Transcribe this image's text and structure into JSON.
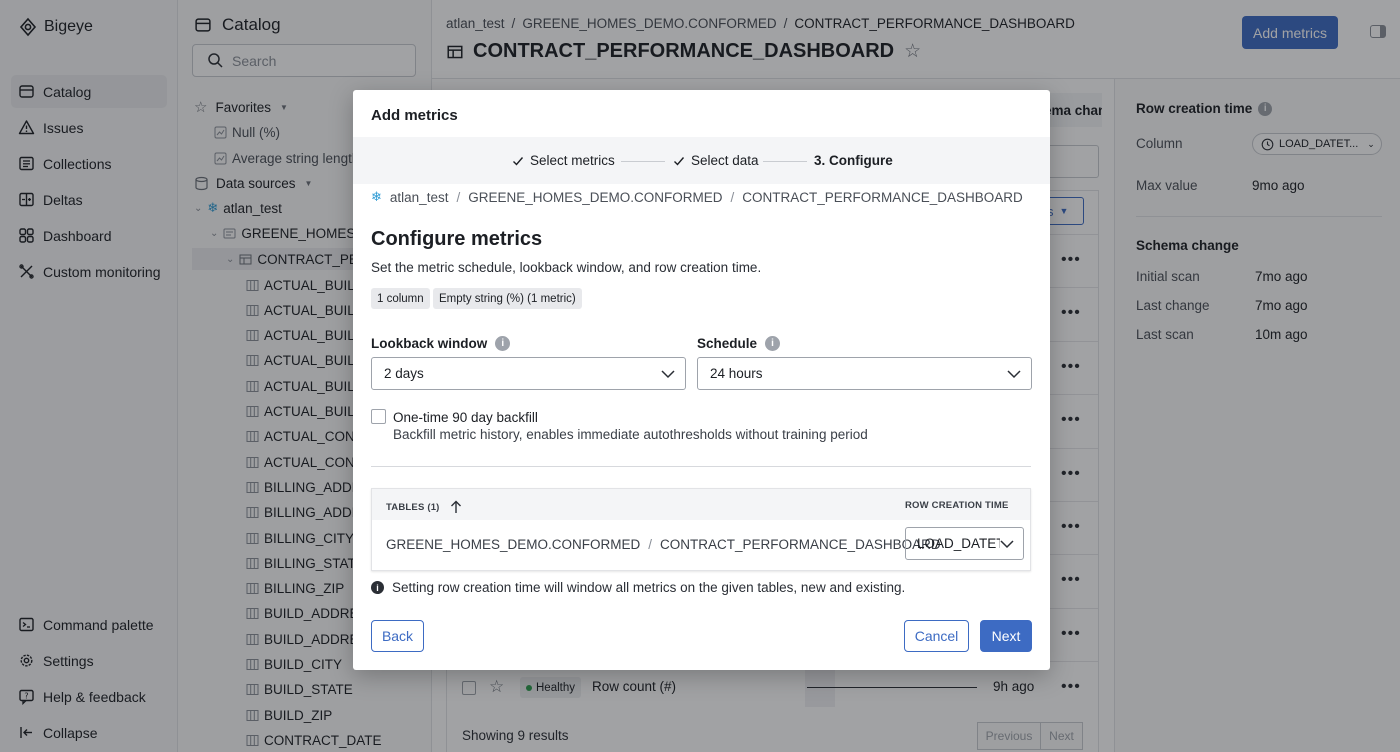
{
  "app": {
    "name": "Bigeye"
  },
  "nav": {
    "items": [
      {
        "label": "Catalog",
        "icon": "catalog-icon"
      },
      {
        "label": "Issues",
        "icon": "warning-icon"
      },
      {
        "label": "Collections",
        "icon": "collections-icon"
      },
      {
        "label": "Deltas",
        "icon": "deltas-icon"
      },
      {
        "label": "Dashboard",
        "icon": "dashboard-icon"
      },
      {
        "label": "Custom monitoring",
        "icon": "custom-monitoring-icon"
      }
    ],
    "bottom": [
      {
        "label": "Command palette",
        "icon": "command-icon"
      },
      {
        "label": "Settings",
        "icon": "gear-icon"
      },
      {
        "label": "Help & feedback",
        "icon": "help-icon"
      },
      {
        "label": "Collapse",
        "icon": "collapse-icon"
      }
    ]
  },
  "catalog": {
    "title": "Catalog",
    "search_placeholder": "Search",
    "favorites": "Favorites",
    "fav_items": [
      "Null (%)",
      "Average string length"
    ],
    "data_sources": "Data sources",
    "source": "atlan_test",
    "schema": "GREENE_HOMES_",
    "table": "CONTRACT_PE",
    "columns": [
      "ACTUAL_BUILD",
      "ACTUAL_BUILD",
      "ACTUAL_BUILD",
      "ACTUAL_BUILD",
      "ACTUAL_BUILD",
      "ACTUAL_BUILD",
      "ACTUAL_CONT",
      "ACTUAL_CONT",
      "BILLING_ADDR",
      "BILLING_ADDR",
      "BILLING_CITY",
      "BILLING_STATE",
      "BILLING_ZIP",
      "BUILD_ADDRES",
      "BUILD_ADDRES",
      "BUILD_CITY",
      "BUILD_STATE",
      "BUILD_ZIP",
      "CONTRACT_DATE"
    ]
  },
  "header": {
    "breadcrumb": [
      "atlan_test",
      "GREENE_HOMES_DEMO.CONFORMED",
      "CONTRACT_PERFORMANCE_DASHBOARD"
    ],
    "title": "CONTRACT_PERFORMANCE_DASHBOARD",
    "add_metrics": "Add metrics"
  },
  "background": {
    "tab_peek": "ema chan",
    "filter_peek": "s",
    "row_status": "Healthy",
    "row_metric": "Row count (#)",
    "row_time": "9h ago",
    "showing": "Showing 9 results",
    "previous": "Previous",
    "next": "Next"
  },
  "right_panel": {
    "row_creation_heading": "Row creation time",
    "column_label": "Column",
    "column_value": "LOAD_DATET...",
    "max_value_label": "Max value",
    "max_value": "9mo ago",
    "schema_heading": "Schema change",
    "initial_scan_label": "Initial scan",
    "initial_scan": "7mo ago",
    "last_change_label": "Last change",
    "last_change": "7mo ago",
    "last_scan_label": "Last scan",
    "last_scan": "10m ago"
  },
  "modal": {
    "title": "Add metrics",
    "steps": [
      "Select metrics",
      "Select data",
      "3. Configure"
    ],
    "breadcrumb": [
      "atlan_test",
      "GREENE_HOMES_DEMO.CONFORMED",
      "CONTRACT_PERFORMANCE_DASHBOARD"
    ],
    "heading": "Configure metrics",
    "subheading": "Set the metric schedule, lookback window, and row creation time.",
    "tags": [
      "1 column",
      "Empty string (%) (1 metric)"
    ],
    "lookback_label": "Lookback window",
    "lookback_value": "2 days",
    "schedule_label": "Schedule",
    "schedule_value": "24 hours",
    "backfill_label": "One-time 90 day backfill",
    "backfill_desc": "Backfill metric history, enables immediate autothresholds without training period",
    "backfill_checked": false,
    "table_col_tables": "TABLES (1)",
    "table_col_rct": "ROW CREATION TIME",
    "table_schema": "GREENE_HOMES_DEMO.CONFORMED",
    "table_name": "CONTRACT_PERFORMANCE_DASHBOARD",
    "rct_value": "LOAD_DATET",
    "note": "Setting row creation time will window all metrics on the given tables, new and existing.",
    "back": "Back",
    "cancel": "Cancel",
    "next": "Next"
  },
  "colors": {
    "primary": "#3d6bc3",
    "healthy": "#2e9e4f"
  }
}
